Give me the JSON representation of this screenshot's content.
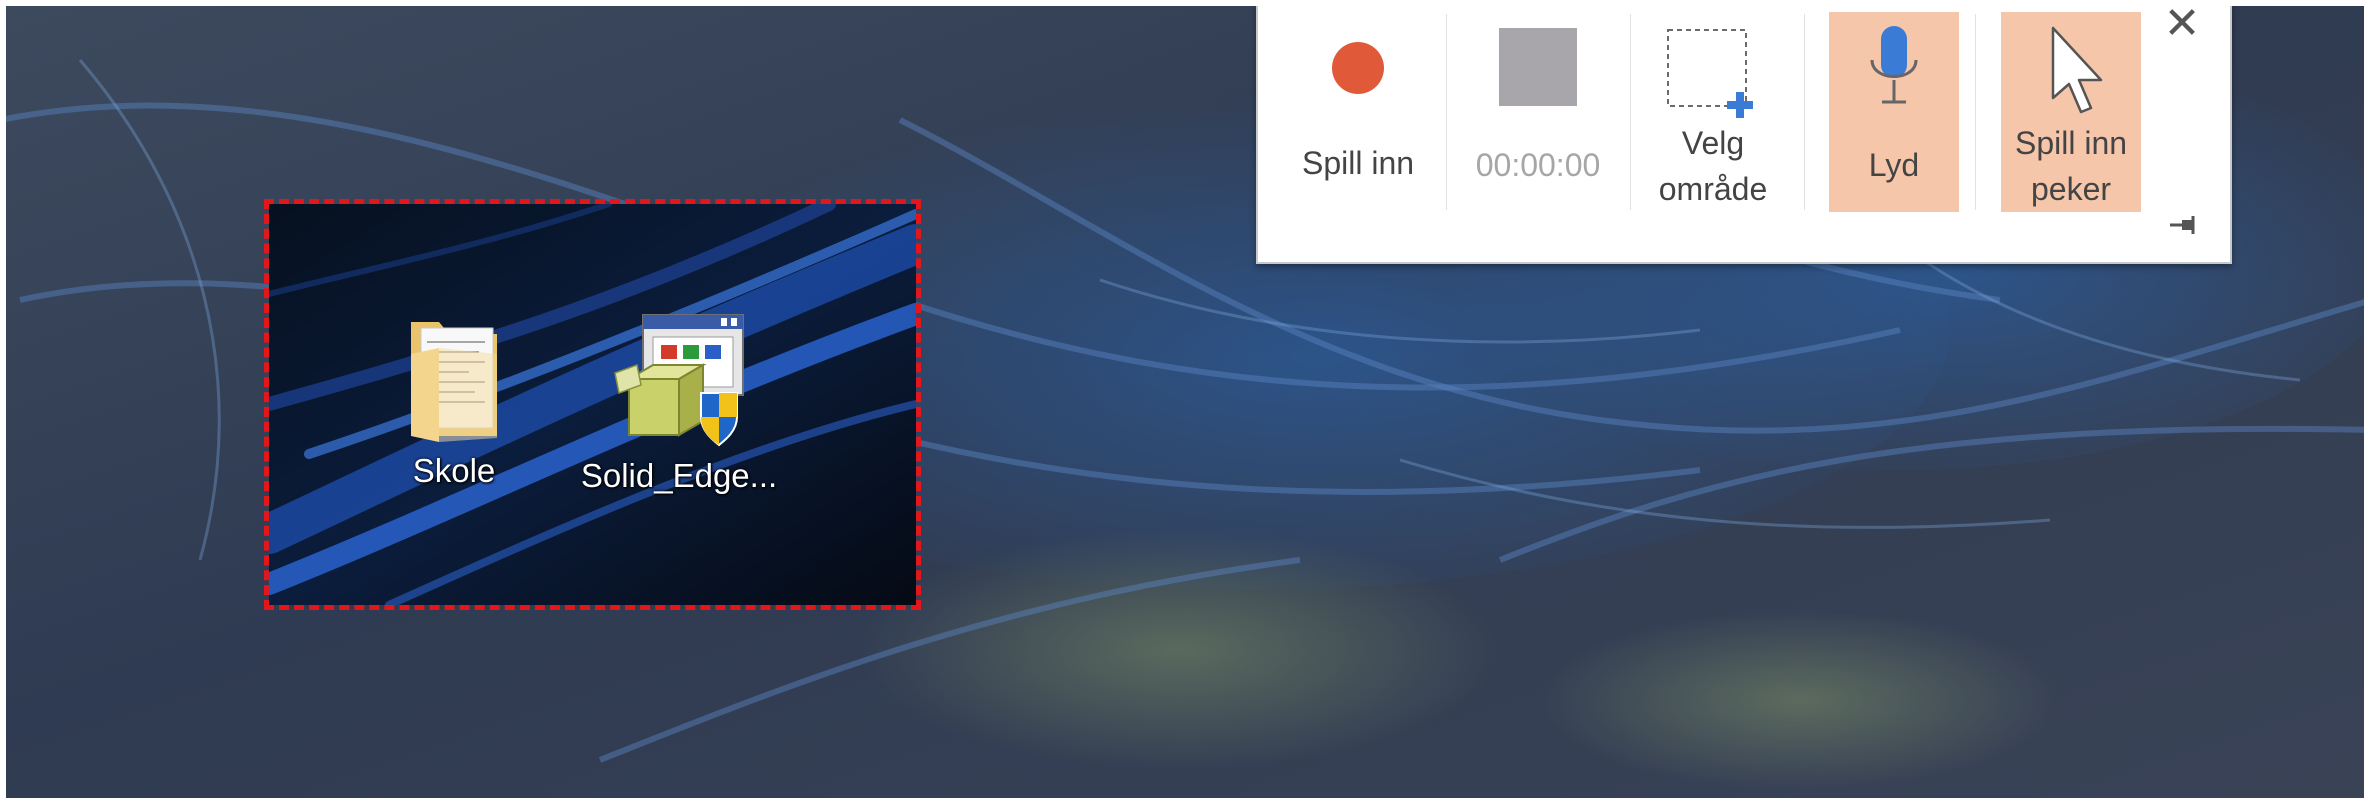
{
  "desktop": {
    "icons": [
      {
        "label": "Skole",
        "icon": "folder-icon"
      },
      {
        "label": "Solid_Edge...",
        "icon": "installer-icon"
      }
    ],
    "selection_border_color": "#e3171b"
  },
  "toolbar": {
    "record": {
      "label": "Spill inn",
      "icon": "record-icon",
      "color": "#e05a3a"
    },
    "timer": {
      "label": "00:00:00",
      "icon": "stop-icon"
    },
    "select_area": {
      "label_line1": "Velg",
      "label_line2": "område",
      "icon": "select-area-icon"
    },
    "audio": {
      "label": "Lyd",
      "icon": "microphone-icon",
      "active": true
    },
    "record_pointer": {
      "label_line1": "Spill inn",
      "label_line2": "peker",
      "icon": "pointer-icon",
      "active": true
    },
    "close": {
      "label": "✕",
      "icon": "close-icon"
    },
    "pin": {
      "icon": "pin-icon"
    },
    "active_color": "#f6c6ab"
  }
}
